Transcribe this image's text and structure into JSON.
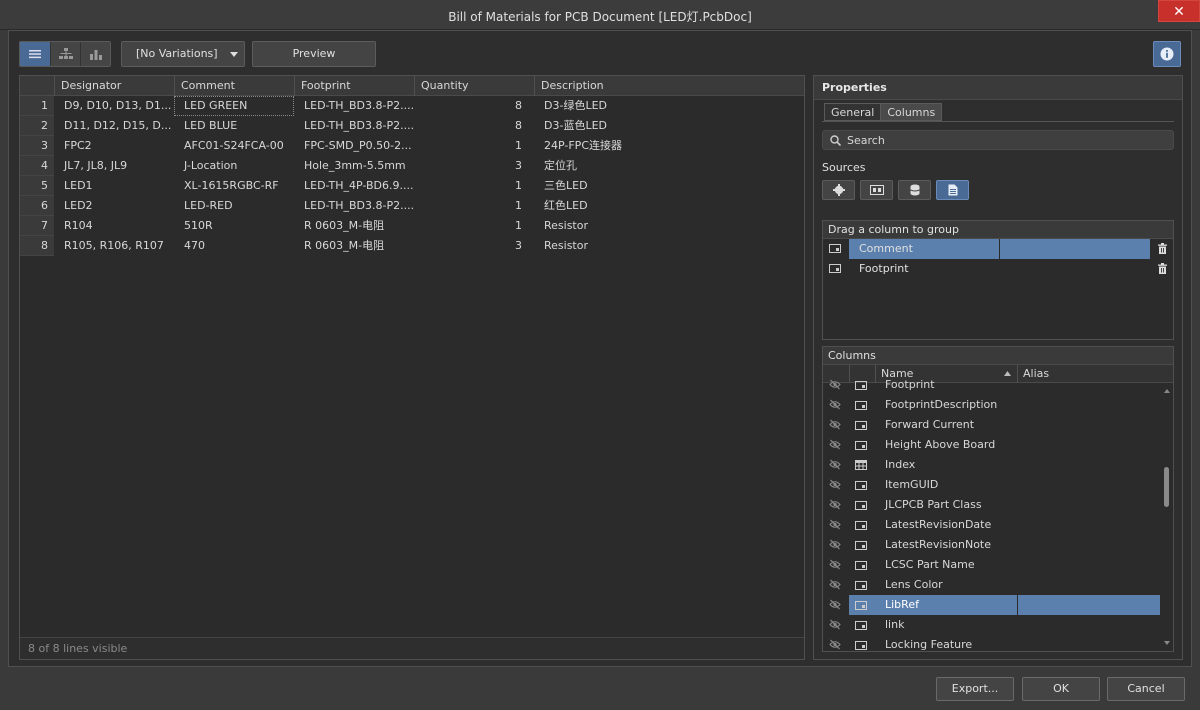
{
  "window": {
    "title": "Bill of Materials for PCB Document [LED灯.PcbDoc]",
    "close_glyph": "✕"
  },
  "toolbar": {
    "variation": "[No Variations]",
    "preview_label": "Preview"
  },
  "grid": {
    "headers": [
      "Designator",
      "Comment",
      "Footprint",
      "Quantity",
      "Description"
    ],
    "rows": [
      {
        "n": "1",
        "designator": "D9, D10, D13, D1...",
        "comment": "LED GREEN",
        "footprint": "LED-TH_BD3.8-P2....",
        "quantity": "8",
        "description": "D3-绿色LED"
      },
      {
        "n": "2",
        "designator": "D11, D12, D15, D...",
        "comment": "LED BLUE",
        "footprint": "LED-TH_BD3.8-P2....",
        "quantity": "8",
        "description": "D3-蓝色LED"
      },
      {
        "n": "3",
        "designator": "FPC2",
        "comment": "AFC01-S24FCA-00",
        "footprint": "FPC-SMD_P0.50-2...",
        "quantity": "1",
        "description": "24P-FPC连接器"
      },
      {
        "n": "4",
        "designator": "JL7, JL8, JL9",
        "comment": "J-Location",
        "footprint": "Hole_3mm-5.5mm",
        "quantity": "3",
        "description": "定位孔"
      },
      {
        "n": "5",
        "designator": "LED1",
        "comment": "XL-1615RGBC-RF",
        "footprint": "LED-TH_4P-BD6.9....",
        "quantity": "1",
        "description": "三色LED"
      },
      {
        "n": "6",
        "designator": "LED2",
        "comment": "LED-RED",
        "footprint": "LED-TH_BD3.8-P2....",
        "quantity": "1",
        "description": "红色LED"
      },
      {
        "n": "7",
        "designator": "R104",
        "comment": "510R",
        "footprint": "R 0603_M-电阻",
        "quantity": "1",
        "description": "Resistor"
      },
      {
        "n": "8",
        "designator": "R105, R106, R107",
        "comment": "470",
        "footprint": "R 0603_M-电阻",
        "quantity": "3",
        "description": "Resistor"
      }
    ],
    "footer": "8 of 8 lines visible"
  },
  "properties": {
    "title": "Properties",
    "tabs": [
      "General",
      "Columns"
    ],
    "search_label": "Search",
    "sources_label": "Sources",
    "group_title": "Drag a column to group",
    "group_items": [
      "Comment",
      "Footprint"
    ],
    "columns_title": "Columns",
    "columns_headers": {
      "name": "Name",
      "alias": "Alias"
    },
    "columns": [
      {
        "name": "Footprint"
      },
      {
        "name": "FootprintDescription"
      },
      {
        "name": "Forward Current"
      },
      {
        "name": "Height Above Board"
      },
      {
        "name": "Index"
      },
      {
        "name": "ItemGUID"
      },
      {
        "name": "JLCPCB Part Class"
      },
      {
        "name": "LatestRevisionDate"
      },
      {
        "name": "LatestRevisionNote"
      },
      {
        "name": "LCSC Part Name"
      },
      {
        "name": "Lens Color"
      },
      {
        "name": "LibRef"
      },
      {
        "name": "link"
      },
      {
        "name": "Locking Feature"
      }
    ]
  },
  "buttons": {
    "export": "Export...",
    "ok": "OK",
    "cancel": "Cancel"
  },
  "colors": {
    "accent": "#4a6a96",
    "selection": "#5b80ad",
    "close": "#c8302b"
  }
}
